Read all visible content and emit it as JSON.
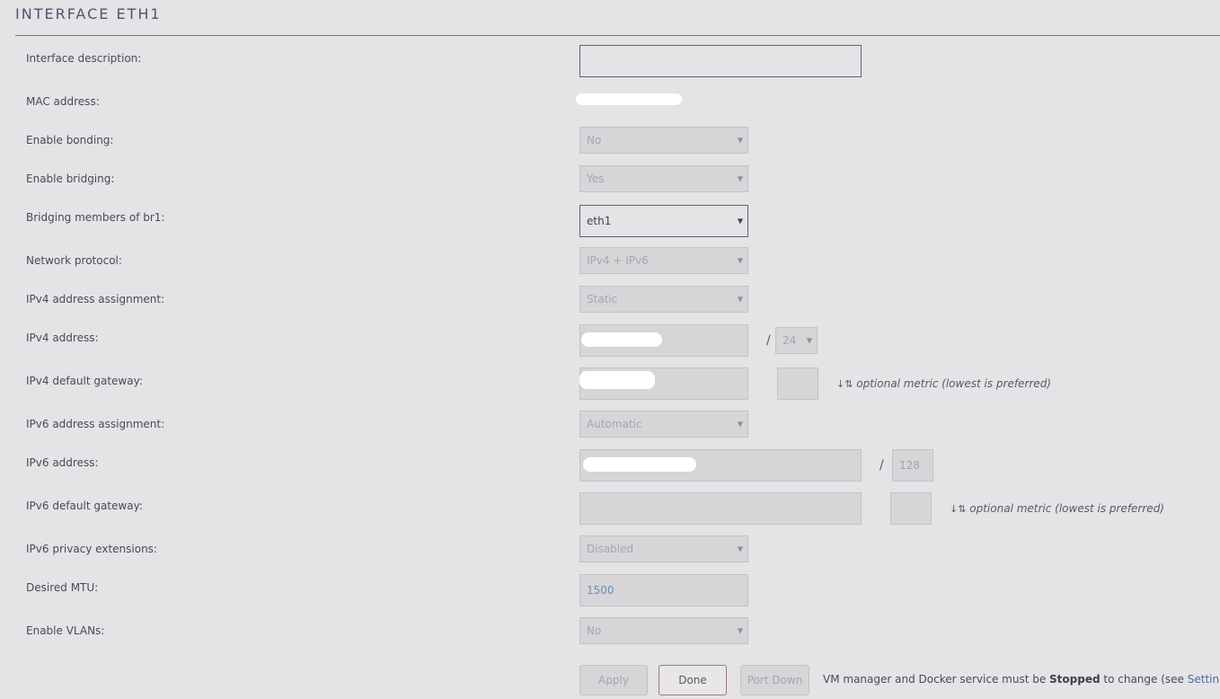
{
  "header": {
    "title": "INTERFACE ETH1"
  },
  "fields": {
    "interface_description": {
      "label": "Interface description:",
      "value": ""
    },
    "mac_address": {
      "label": "MAC address:"
    },
    "enable_bonding": {
      "label": "Enable bonding:",
      "value": "No"
    },
    "enable_bridging": {
      "label": "Enable bridging:",
      "value": "Yes"
    },
    "bridging_members": {
      "label": "Bridging members of br1:",
      "value": "eth1"
    },
    "network_protocol": {
      "label": "Network protocol:",
      "value": "IPv4 + IPv6"
    },
    "ipv4_assignment": {
      "label": "IPv4 address assignment:",
      "value": "Static"
    },
    "ipv4_address": {
      "label": "IPv4 address:",
      "slash": "/",
      "prefix": "24"
    },
    "ipv4_gateway": {
      "label": "IPv4 default gateway:",
      "metric_hint": "optional metric (lowest is preferred)"
    },
    "ipv6_assignment": {
      "label": "IPv6 address assignment:",
      "value": "Automatic"
    },
    "ipv6_address": {
      "label": "IPv6 address:",
      "slash": "/",
      "prefix": "128"
    },
    "ipv6_gateway": {
      "label": "IPv6 default gateway:",
      "metric_hint": "optional metric (lowest is preferred)"
    },
    "ipv6_privacy": {
      "label": "IPv6 privacy extensions:",
      "value": "Disabled"
    },
    "mtu": {
      "label": "Desired MTU:",
      "value": "1500"
    },
    "enable_vlans": {
      "label": "Enable VLANs:",
      "value": "No"
    }
  },
  "buttons": {
    "apply": "Apply",
    "done": "Done",
    "port_down": "Port Down"
  },
  "footer_note": {
    "prefix": "VM manager and Docker service must be ",
    "bold": "Stopped",
    "middle": " to change (see ",
    "link": "Settings",
    "suffix": ")"
  },
  "icons": {
    "select_arrow": "▼",
    "sort_icon": "↓⇅"
  }
}
